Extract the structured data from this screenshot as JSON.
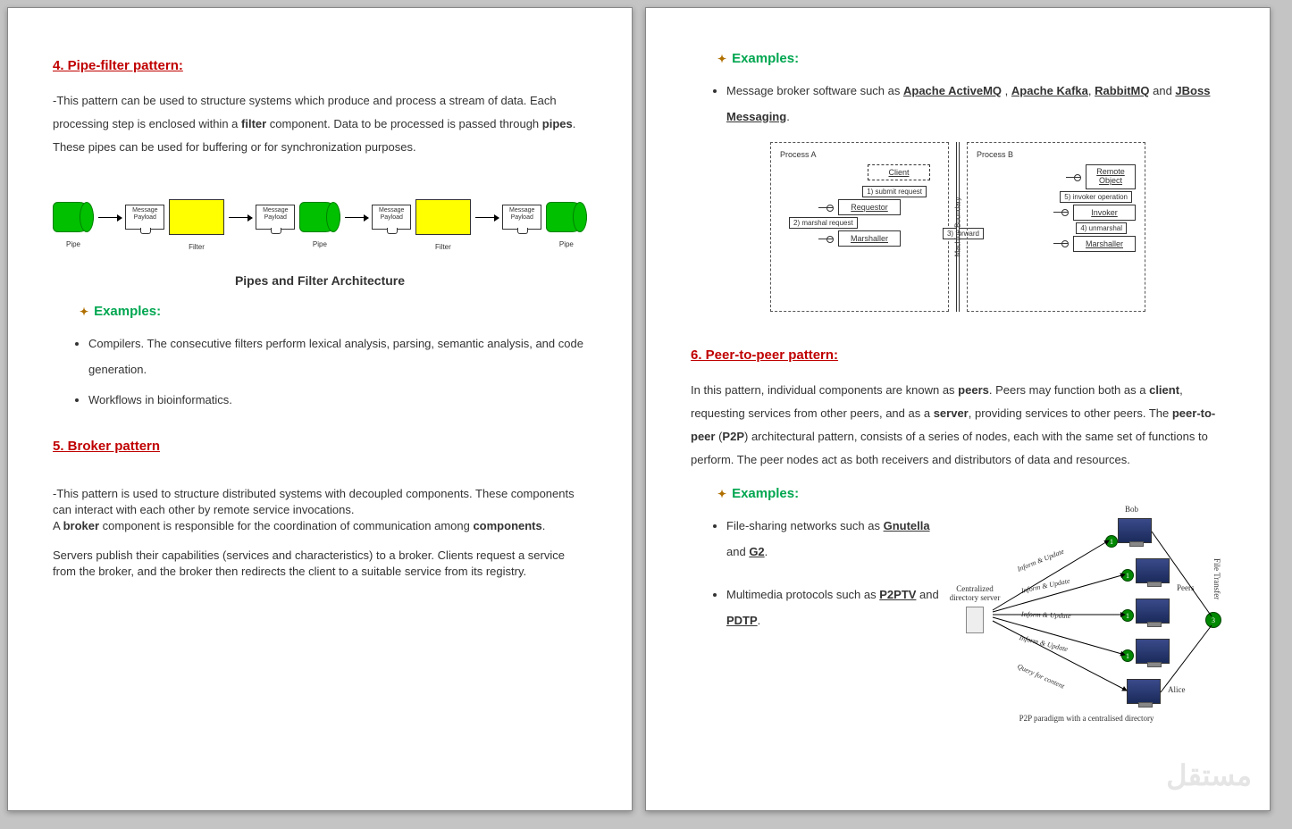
{
  "page1": {
    "h4": "4. Pipe-filter pattern:",
    "p4a": "-This pattern can be used to structure systems which produce and process a stream of data. Each processing step is enclosed within a ",
    "p4b": "filter",
    "p4c": " component. Data to be processed is passed through ",
    "p4d": "pipes",
    "p4e": ". These pipes can be used for buffering or for synchronization purposes.",
    "pipe_label": "Pipe",
    "filter_label": "Filter",
    "msg_label": "Message\nPayload",
    "diagram_caption": "Pipes and Filter Architecture",
    "examples_label": "Examples:",
    "ex4_1": "Compilers. The consecutive filters perform lexical analysis, parsing, semantic analysis, and code generation.",
    "ex4_2": "Workflows in bioinformatics.",
    "h5": "5. Broker pattern",
    "p5a": "-This pattern is used to structure distributed systems with decoupled components. These components can interact with each other by remote service invocations.\nA ",
    "p5b": "broker",
    "p5c": " component is responsible for the coordination of communication among ",
    "p5d": "components",
    "p5e": ".",
    "p5f": "Servers publish their capabilities (services and characteristics) to a broker. Clients request a service from the broker, and the broker then redirects the client to a suitable service from its registry."
  },
  "page2": {
    "examples_label": "Examples:",
    "broker_ex_a": "Message broker software such as ",
    "broker_link1": "Apache ActiveMQ",
    "broker_link2": "Apache Kafka",
    "broker_link3": "RabbitMQ",
    "broker_link4": "JBoss Messaging",
    "diagram": {
      "proc_a": "Process A",
      "proc_b": "Process B",
      "client": "Client",
      "requestor": "Requestor",
      "marshaller": "Marshaller",
      "remote_obj": "Remote Object",
      "invoker": "Invoker",
      "step1": "1) submit request",
      "step2": "2) marshal request",
      "step3": "3) forward",
      "step4": "4) unmarshal",
      "step5": "5) invoker operation"
    },
    "h6": "6. Peer-to-peer pattern:",
    "p6a": "In this pattern, individual components are known as ",
    "p6b": "peers",
    "p6c": ". Peers may function both as a ",
    "p6d": "client",
    "p6e": ", requesting services from other peers, and as a ",
    "p6f": "server",
    "p6g": ", providing services to other peers. The ",
    "p6h": "peer-to-peer",
    "p6i": " (",
    "p6j": "P2P",
    "p6k": ") architectural pattern, consists of a series of nodes, each with the same set of functions to perform. The peer nodes act as both receivers and distributors of data and resources.",
    "ex6_1a": "File-sharing networks such as ",
    "ex6_1b": "Gnutella",
    "ex6_1c": " and ",
    "ex6_1d": "G2",
    "ex6_1e": ".",
    "ex6_2a": "Multimedia protocols such as ",
    "ex6_2b": "P2PTV",
    "ex6_2c": " and ",
    "ex6_2d": "PDTP",
    "ex6_2e": ".",
    "p2p": {
      "bob": "Bob",
      "peers": "Peers",
      "alice": "Alice",
      "server": "Centralized directory server",
      "inform": "Inform & Update",
      "query": "Query for content",
      "file_transfer": "File Transfer",
      "n1": "1",
      "n3": "3",
      "caption": "P2P paradigm with a centralised directory"
    },
    "watermark": "مستقل"
  }
}
